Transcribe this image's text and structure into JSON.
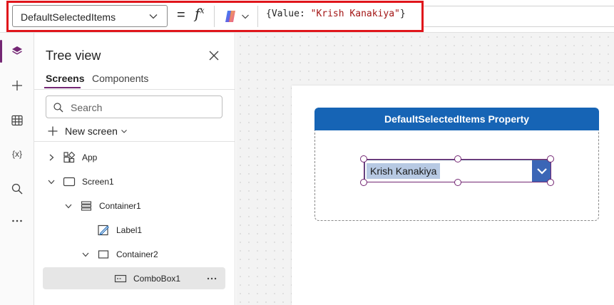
{
  "formula_bar": {
    "property": "DefaultSelectedItems",
    "equals": "=",
    "fx": "fx",
    "formula_open": "{",
    "formula_key": "Value: ",
    "formula_string": "\"Krish Kanakiya\"",
    "formula_close": "}"
  },
  "left_rail": {
    "items": [
      "layers-icon",
      "plus-icon",
      "table-icon",
      "variables-icon",
      "search-icon",
      "more-icon"
    ],
    "variables_label": "{x}"
  },
  "tree_view": {
    "title": "Tree view",
    "tabs": [
      "Screens",
      "Components"
    ],
    "active_tab": "Screens",
    "search_placeholder": "Search",
    "new_screen_label": "New screen",
    "nodes": [
      {
        "label": "App",
        "icon": "app-icon",
        "expanded": false
      },
      {
        "label": "Screen1",
        "icon": "screen-icon",
        "expanded": true
      },
      {
        "label": "Container1",
        "icon": "container-icon",
        "expanded": true
      },
      {
        "label": "Label1",
        "icon": "label-icon"
      },
      {
        "label": "Container2",
        "icon": "container-icon",
        "expanded": true
      },
      {
        "label": "ComboBox1",
        "icon": "combobox-icon",
        "selected": true
      }
    ]
  },
  "canvas": {
    "header_label": "DefaultSelectedItems Property",
    "combobox_value": "Krish Kanakiya"
  },
  "colors": {
    "accent": "#742774",
    "header_blue": "#1664b5",
    "highlight_red": "#e0151b",
    "combo_button": "#3b66b6"
  }
}
